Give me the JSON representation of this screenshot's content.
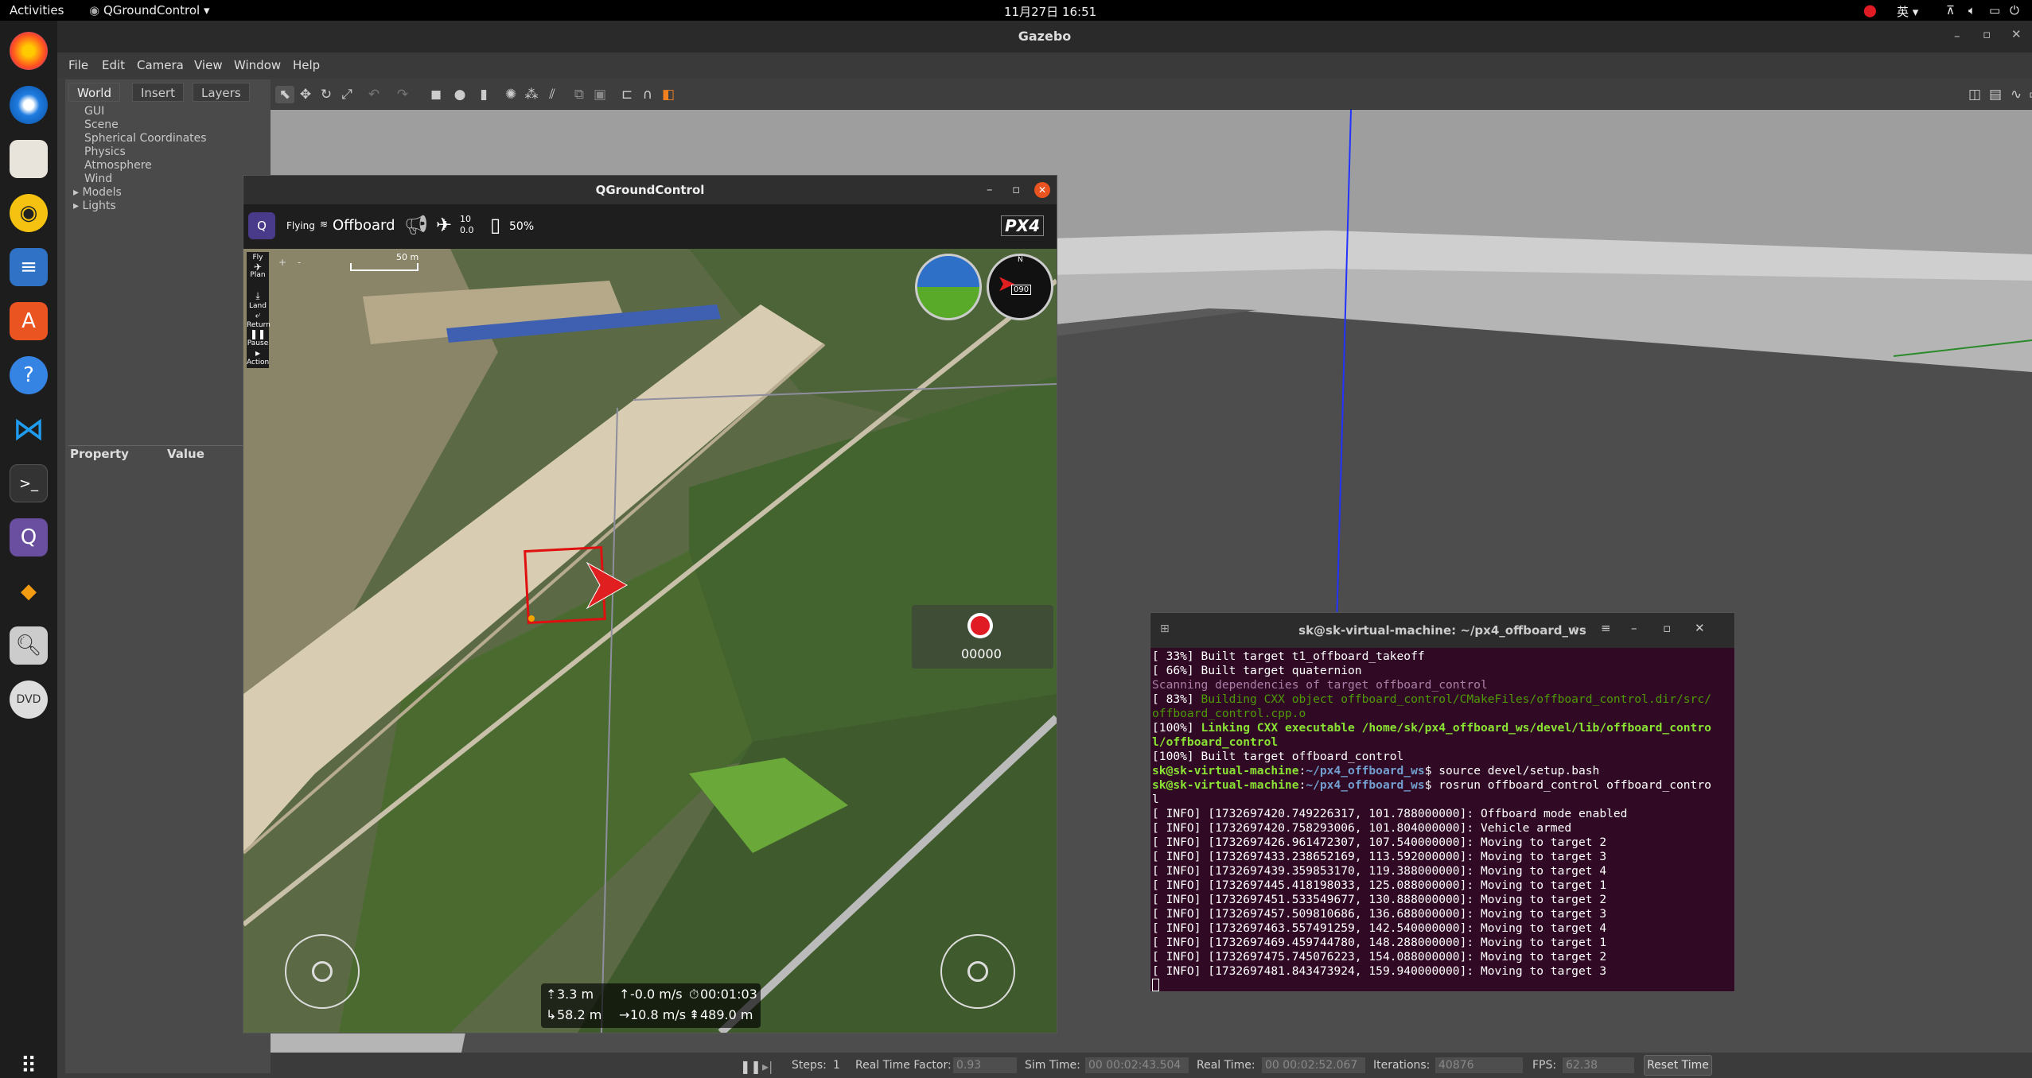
{
  "topbar": {
    "activities": "Activities",
    "app_menu": "QGroundControl ▾",
    "datetime": "11月27日 16:51",
    "ime": "英 ▾"
  },
  "dock": {
    "items": [
      "firefox-icon",
      "thunderbird-icon",
      "files-icon",
      "rhythmbox-icon",
      "writer-icon",
      "app-center-icon",
      "help-icon",
      "vscode-icon",
      "terminal-icon",
      "qgroundcontrol-icon",
      "app-icon",
      "search-app-icon",
      "dvd-icon",
      "apps-grid-icon"
    ]
  },
  "gazebo": {
    "title": "Gazebo",
    "menu": [
      "File",
      "Edit",
      "Camera",
      "View",
      "Window",
      "Help"
    ],
    "tabs": [
      "World",
      "Insert",
      "Layers"
    ],
    "tree": [
      "GUI",
      "Scene",
      "Spherical Coordinates",
      "Physics",
      "Atmosphere",
      "Wind",
      "Models",
      "Lights"
    ],
    "property_header": "Property",
    "value_header": "Value",
    "bottom": {
      "steps_label": "Steps:",
      "steps_value": "1",
      "rtf_label": "Real Time Factor:",
      "rtf_value": "0.93",
      "sim_label": "Sim Time:",
      "sim_value": "00 00:02:43.504",
      "real_label": "Real Time:",
      "real_value": "00 00:02:52.067",
      "iter_label": "Iterations:",
      "iter_value": "40876",
      "fps_label": "FPS:",
      "fps_value": "62.38",
      "reset_label": "Reset Time"
    }
  },
  "qgc": {
    "title": "QGroundControl",
    "status": "Flying",
    "mode": "Offboard",
    "sat_count": "10",
    "sat_hdop": "0.0",
    "battery": "50%",
    "logo": "PX4",
    "scale": "50 m",
    "tools": [
      {
        "icon": "fly-icon",
        "label": "Fly"
      },
      {
        "icon": "plan-icon",
        "label": "Plan"
      },
      {
        "icon": "land-icon",
        "label": "Land"
      },
      {
        "icon": "return-icon",
        "label": "Return"
      },
      {
        "icon": "pause-icon",
        "label": "Pause"
      },
      {
        "icon": "action-icon",
        "label": "Action"
      }
    ],
    "compass_heading": "090",
    "record_counter": "00000",
    "telemetry": {
      "alt": "3.3 m",
      "vspeed": "-0.0 m/s",
      "time": "00:01:03",
      "dist": "58.2 m",
      "hspeed": "10.8 m/s",
      "home": "489.0 m"
    }
  },
  "terminal": {
    "title": "sk@sk-virtual-machine: ~/px4_offboard_ws",
    "lines": [
      {
        "parts": [
          {
            "t": "[ 33%] Built target t1_offboard_takeoff",
            "c": ""
          }
        ]
      },
      {
        "parts": [
          {
            "t": "[ 66%] Built target quaternion",
            "c": ""
          }
        ]
      },
      {
        "parts": [
          {
            "t": "Scanning dependencies of target offboard_control",
            "c": "p"
          }
        ]
      },
      {
        "parts": [
          {
            "t": "[ 83%] ",
            "c": ""
          },
          {
            "t": "Building CXX object offboard_control/CMakeFiles/offboard_control.dir/src/",
            "c": "g"
          }
        ]
      },
      {
        "parts": [
          {
            "t": "offboard_control.cpp.o",
            "c": "g"
          }
        ]
      },
      {
        "parts": [
          {
            "t": "[100%] ",
            "c": ""
          },
          {
            "t": "Linking CXX executable /home/sk/px4_offboard_ws/devel/lib/offboard_contro",
            "c": "gb"
          }
        ]
      },
      {
        "parts": [
          {
            "t": "l/offboard_control",
            "c": "gb"
          }
        ]
      },
      {
        "parts": [
          {
            "t": "[100%] Built target offboard_control",
            "c": ""
          }
        ]
      },
      {
        "parts": [
          {
            "t": "sk@sk-virtual-machine",
            "c": "gb"
          },
          {
            "t": ":",
            "c": ""
          },
          {
            "t": "~/px4_offboard_ws",
            "c": "bb"
          },
          {
            "t": "$ source devel/setup.bash",
            "c": ""
          }
        ]
      },
      {
        "parts": [
          {
            "t": "sk@sk-virtual-machine",
            "c": "gb"
          },
          {
            "t": ":",
            "c": ""
          },
          {
            "t": "~/px4_offboard_ws",
            "c": "bb"
          },
          {
            "t": "$ rosrun offboard_control offboard_contro",
            "c": ""
          }
        ]
      },
      {
        "parts": [
          {
            "t": "l",
            "c": ""
          }
        ]
      },
      {
        "parts": [
          {
            "t": "[ INFO] [1732697420.749226317, 101.788000000]: Offboard mode enabled",
            "c": ""
          }
        ]
      },
      {
        "parts": [
          {
            "t": "[ INFO] [1732697420.758293006, 101.804000000]: Vehicle armed",
            "c": ""
          }
        ]
      },
      {
        "parts": [
          {
            "t": "[ INFO] [1732697426.961472307, 107.540000000]: Moving to target 2",
            "c": ""
          }
        ]
      },
      {
        "parts": [
          {
            "t": "[ INFO] [1732697433.238652169, 113.592000000]: Moving to target 3",
            "c": ""
          }
        ]
      },
      {
        "parts": [
          {
            "t": "[ INFO] [1732697439.359853170, 119.388000000]: Moving to target 4",
            "c": ""
          }
        ]
      },
      {
        "parts": [
          {
            "t": "[ INFO] [1732697445.418198033, 125.088000000]: Moving to target 1",
            "c": ""
          }
        ]
      },
      {
        "parts": [
          {
            "t": "[ INFO] [1732697451.533549677, 130.888000000]: Moving to target 2",
            "c": ""
          }
        ]
      },
      {
        "parts": [
          {
            "t": "[ INFO] [1732697457.509810686, 136.688000000]: Moving to target 3",
            "c": ""
          }
        ]
      },
      {
        "parts": [
          {
            "t": "[ INFO] [1732697463.557491259, 142.540000000]: Moving to target 4",
            "c": ""
          }
        ]
      },
      {
        "parts": [
          {
            "t": "[ INFO] [1732697469.459744780, 148.288000000]: Moving to target 1",
            "c": ""
          }
        ]
      },
      {
        "parts": [
          {
            "t": "[ INFO] [1732697475.745076223, 154.088000000]: Moving to target 2",
            "c": ""
          }
        ]
      },
      {
        "parts": [
          {
            "t": "[ INFO] [1732697481.843473924, 159.940000000]: Moving to target 3",
            "c": ""
          }
        ]
      }
    ]
  }
}
